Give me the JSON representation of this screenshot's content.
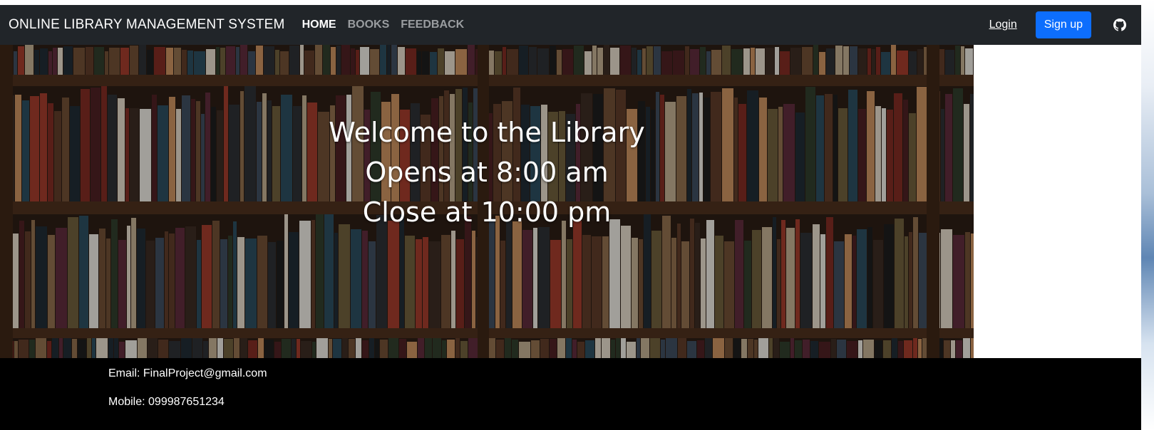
{
  "navbar": {
    "brand": "ONLINE LIBRARY MANAGEMENT SYSTEM",
    "links": [
      {
        "label": "HOME",
        "active": true
      },
      {
        "label": "BOOKS",
        "active": false
      },
      {
        "label": "FEEDBACK",
        "active": false
      }
    ],
    "login_label": "Login",
    "signup_label": "Sign up",
    "github_icon": "github-icon"
  },
  "hero": {
    "line1": "Welcome to the Library",
    "line2": "Opens at 8:00 am",
    "line3": "Close at 10:00 pm"
  },
  "footer": {
    "email": "Email: FinalProject@gmail.com",
    "mobile": "Mobile: 099987651234"
  },
  "colors": {
    "navbar_bg": "#212529",
    "signup_bg": "#0d6efd",
    "footer_bg": "#000000"
  }
}
